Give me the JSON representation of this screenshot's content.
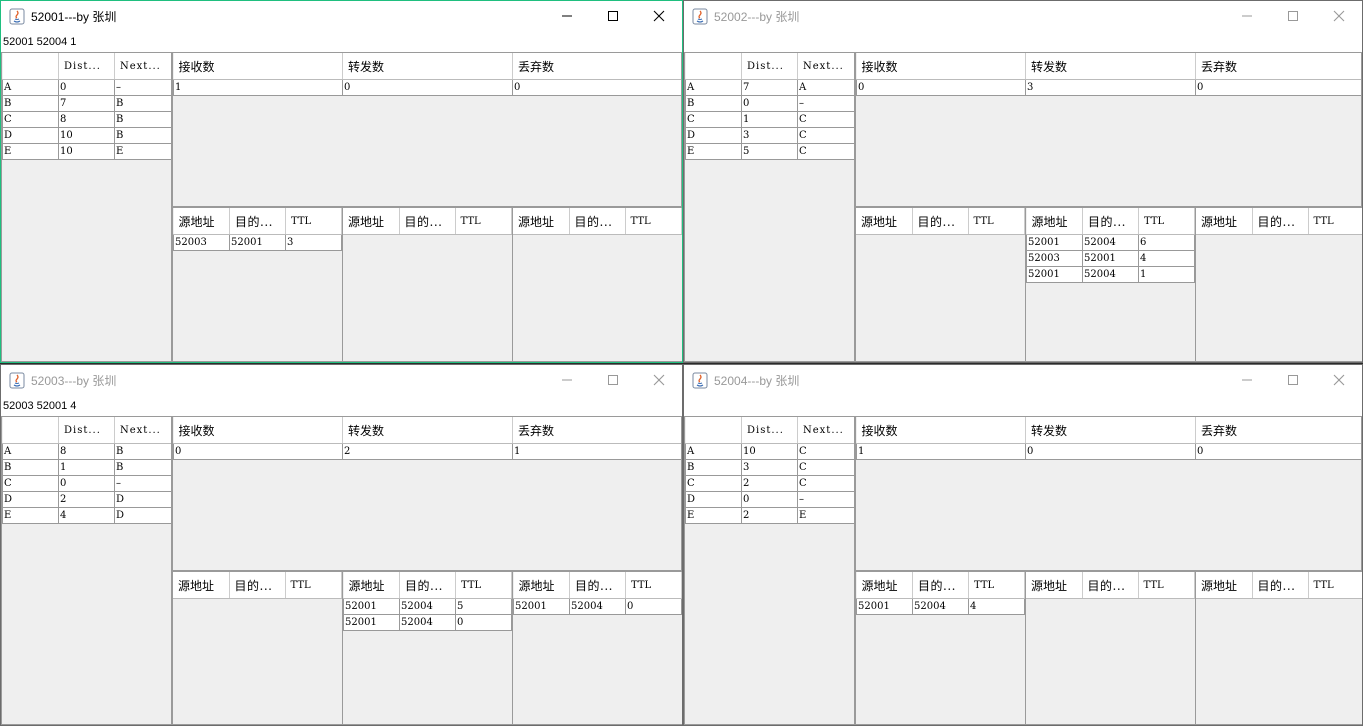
{
  "headers": {
    "route": [
      "",
      "Dist...",
      "Next..."
    ],
    "stats": [
      "接收数",
      "转发数",
      "丢弃数"
    ],
    "packet": [
      "源地址",
      "目的...",
      "TTL"
    ]
  },
  "windows": [
    {
      "title": "52001---by 张圳",
      "info": "52001 52004 1",
      "active": true,
      "route": [
        [
          "A",
          "0",
          "–"
        ],
        [
          "B",
          "7",
          "B"
        ],
        [
          "C",
          "8",
          "B"
        ],
        [
          "D",
          "10",
          "B"
        ],
        [
          "E",
          "10",
          "E"
        ]
      ],
      "stats": [
        "1",
        "0",
        "0"
      ],
      "queues": [
        [
          [
            "52003",
            "52001",
            "3"
          ]
        ],
        [],
        []
      ]
    },
    {
      "title": "52002---by 张圳",
      "info": "",
      "active": false,
      "route": [
        [
          "A",
          "7",
          "A"
        ],
        [
          "B",
          "0",
          "–"
        ],
        [
          "C",
          "1",
          "C"
        ],
        [
          "D",
          "3",
          "C"
        ],
        [
          "E",
          "5",
          "C"
        ]
      ],
      "stats": [
        "0",
        "3",
        "0"
      ],
      "queues": [
        [],
        [
          [
            "52001",
            "52004",
            "6"
          ],
          [
            "52003",
            "52001",
            "4"
          ],
          [
            "52001",
            "52004",
            "1"
          ]
        ],
        []
      ]
    },
    {
      "title": "52003---by 张圳",
      "info": "52003 52001 4",
      "active": false,
      "route": [
        [
          "A",
          "8",
          "B"
        ],
        [
          "B",
          "1",
          "B"
        ],
        [
          "C",
          "0",
          "–"
        ],
        [
          "D",
          "2",
          "D"
        ],
        [
          "E",
          "4",
          "D"
        ]
      ],
      "stats": [
        "0",
        "2",
        "1"
      ],
      "queues": [
        [],
        [
          [
            "52001",
            "52004",
            "5"
          ],
          [
            "52001",
            "52004",
            "0"
          ]
        ],
        [
          [
            "52001",
            "52004",
            "0"
          ]
        ]
      ]
    },
    {
      "title": "52004---by 张圳",
      "info": "",
      "active": false,
      "route": [
        [
          "A",
          "10",
          "C"
        ],
        [
          "B",
          "3",
          "C"
        ],
        [
          "C",
          "2",
          "C"
        ],
        [
          "D",
          "0",
          "–"
        ],
        [
          "E",
          "2",
          "E"
        ]
      ],
      "stats": [
        "1",
        "0",
        "0"
      ],
      "queues": [
        [
          [
            "52001",
            "52004",
            "4"
          ]
        ],
        [],
        []
      ]
    }
  ]
}
